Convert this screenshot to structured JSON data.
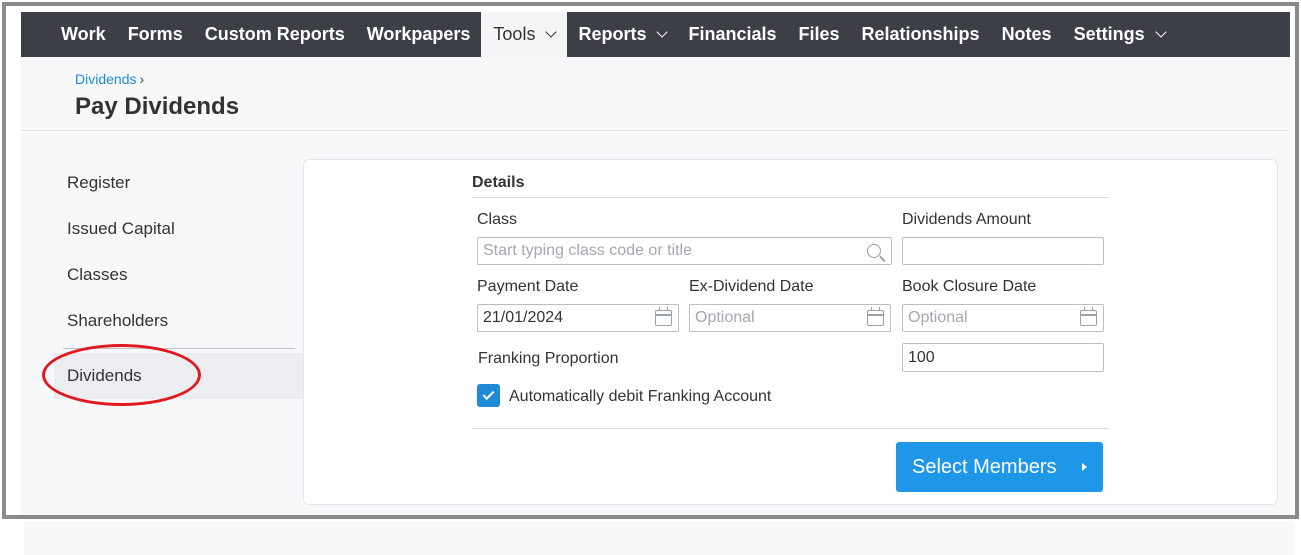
{
  "nav": {
    "items": [
      {
        "label": "Work"
      },
      {
        "label": "Forms"
      },
      {
        "label": "Custom Reports"
      },
      {
        "label": "Workpapers"
      },
      {
        "label": "Tools"
      },
      {
        "label": "Reports"
      },
      {
        "label": "Financials"
      },
      {
        "label": "Files"
      },
      {
        "label": "Relationships"
      },
      {
        "label": "Notes"
      },
      {
        "label": "Settings"
      }
    ],
    "active": "Tools"
  },
  "header": {
    "breadcrumb": "Dividends",
    "breadcrumb_sep": "›",
    "title": "Pay Dividends"
  },
  "sidebar": {
    "items": [
      {
        "label": "Register"
      },
      {
        "label": "Issued Capital"
      },
      {
        "label": "Classes"
      },
      {
        "label": "Shareholders"
      },
      {
        "label": "Dividends"
      }
    ],
    "selected": "Dividends"
  },
  "form": {
    "section_title": "Details",
    "class": {
      "label": "Class",
      "placeholder": "Start typing class code or title",
      "value": ""
    },
    "dividends_amount": {
      "label": "Dividends Amount",
      "value": ""
    },
    "payment_date": {
      "label": "Payment Date",
      "value": "21/01/2024"
    },
    "ex_dividend_date": {
      "label": "Ex-Dividend Date",
      "placeholder": "Optional",
      "value": ""
    },
    "book_closure_date": {
      "label": "Book Closure Date",
      "placeholder": "Optional",
      "value": ""
    },
    "franking_proportion": {
      "label": "Franking Proportion",
      "value": "100"
    },
    "auto_debit": {
      "label": "Automatically debit Franking Account",
      "checked": true
    },
    "submit_label": "Select Members"
  },
  "colors": {
    "nav_bg": "#3d3f47",
    "accent": "#1f97e8",
    "link": "#1f8ad8",
    "annotation": "#e0191f"
  },
  "icons": {
    "search": "search-icon",
    "calendar": "calendar-icon",
    "check": "checkmark-icon",
    "chevron": "chevron-down-icon",
    "arrow": "arrow-right-icon"
  }
}
